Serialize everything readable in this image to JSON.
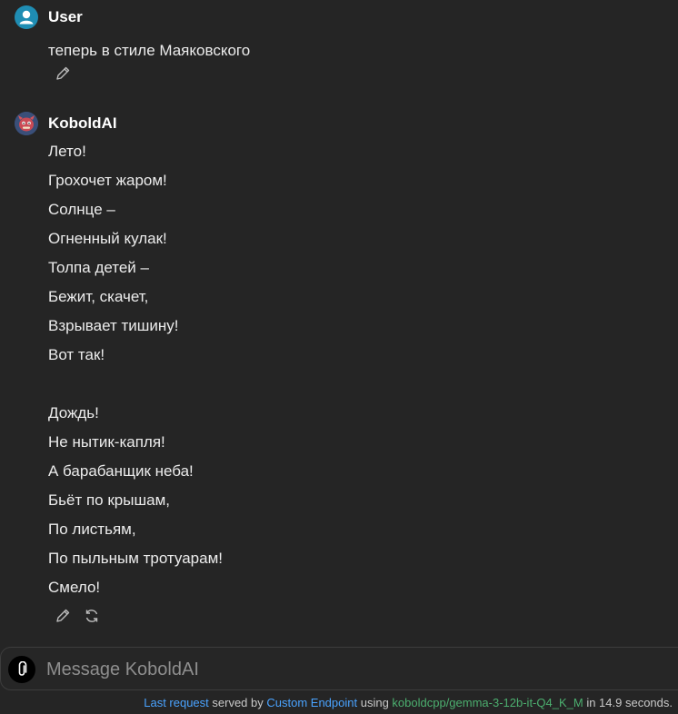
{
  "messages": [
    {
      "sender": "User",
      "avatar": "user-icon",
      "lines": [
        "теперь в стиле Маяковского"
      ]
    },
    {
      "sender": "KoboldAI",
      "avatar": "kobold-icon",
      "lines": [
        "Лето!",
        "Грохочет жаром!",
        "Солнце –",
        "Огненный кулак!",
        "Толпа детей –",
        "Бежит, скачет,",
        "Взрывает тишину!",
        "Вот так!",
        "",
        "Дождь!",
        "Не нытик-капля!",
        "А барабанщик неба!",
        "Бьёт по крышам,",
        "По листьям,",
        "По пыльным тротуарам!",
        "Смело!"
      ]
    }
  ],
  "composer": {
    "placeholder": "Message KoboldAI",
    "attach_icon": "paperclip-icon"
  },
  "footer": {
    "last_request": "Last request",
    "served_by": " served by ",
    "endpoint": "Custom Endpoint",
    "using": " using ",
    "model": "koboldcpp/gemma-3-12b-it-Q4_K_M",
    "in_text": " in 14.9 seconds."
  },
  "colors": {
    "background": "#252525",
    "user_avatar": "#1f8db3",
    "link_blue": "#4aa3ff",
    "link_green": "#4caf6f"
  }
}
